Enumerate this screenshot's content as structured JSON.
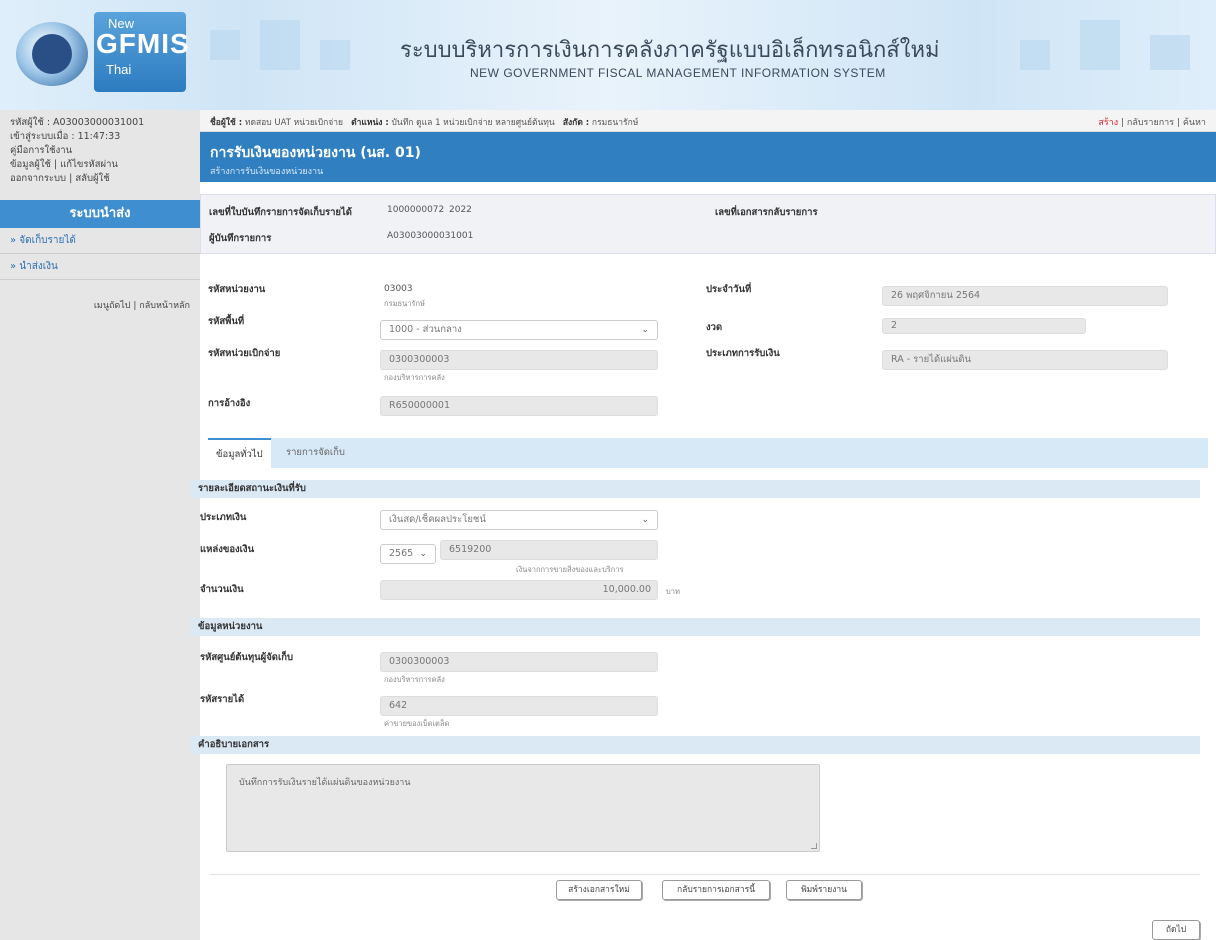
{
  "header": {
    "logo": {
      "new": "New",
      "gfmis": "GFMIS",
      "thai": "Thai"
    },
    "title_th": "ระบบบริหารการเงินการคลังภาครัฐแบบอิเล็กทรอนิกส์ใหม่",
    "title_en": "NEW GOVERNMENT FISCAL MANAGEMENT INFORMATION SYSTEM"
  },
  "sidebar": {
    "user_code": "รหัสผู้ใช้ : A03003000031001",
    "login_time": "เข้าสู่ระบบเมื่อ : 11:47:33",
    "manual": "คู่มือการใช้งาน",
    "user_info": "ข้อมูลผู้ใช้",
    "password": "แก้ไขรหัสผ่าน",
    "logout": "ออกจากระบบ",
    "switch_user": "สลับผู้ใช้",
    "title": "ระบบนำส่ง",
    "menu": [
      "» จัดเก็บรายได้",
      "» นำส่งเงิน"
    ],
    "next_page": "เมนูถัดไป",
    "home": "กลับหน้าหลัก"
  },
  "topbar": {
    "user_label": "ชื่อผู้ใช้ :",
    "user_value": "ทดสอบ UAT หน่วยเบิกจ่าย",
    "position_label": "ตำแหน่ง :",
    "position_value": "บันทึก ดูแล 1 หน่วยเบิกจ่าย หลายศูนย์ต้นทุน",
    "org_label": "สังกัด :",
    "org_value": "กรมธนารักษ์",
    "create": "สร้าง",
    "back_list": "กลับรายการ",
    "search": "ค้นหา"
  },
  "title": {
    "main": "การรับเงินของหน่วยงาน (นส. 01)",
    "sub": "สร้างการรับเงินของหน่วยงาน"
  },
  "doc": {
    "doc_no_label": "เลขที่ใบบันทึกรายการจัดเก็บรายได้",
    "doc_no_value": "1000000072",
    "doc_year": "2022",
    "ref_doc_label": "เลขที่เอกสารกลับรายการ",
    "recorder_label": "ผู้บันทึกรายการ",
    "recorder_value": "A03003000031001"
  },
  "form": {
    "agency_label": "รหัสหน่วยงาน",
    "agency_value": "03003",
    "agency_name": "กรมธนารักษ์",
    "date_label": "ประจำวันที่",
    "date_value": "26 พฤศจิกายน 2564",
    "area_label": "รหัสพื้นที่",
    "area_value": "1000 - ส่วนกลาง",
    "period_label": "งวด",
    "period_value": "2",
    "disb_label": "รหัสหน่วยเบิกจ่าย",
    "disb_value": "0300300003",
    "disb_name": "กองบริหารการคลัง",
    "type_label": "ประเภทการรับเงิน",
    "type_value": "RA - รายได้แผ่นดิน",
    "ref_label": "การอ้างอิง",
    "ref_value": "R650000001"
  },
  "tabs": [
    "ข้อมูลทั่วไป",
    "รายการจัดเก็บ"
  ],
  "money": {
    "section": "รายละเอียดสถานะเงินที่รับ",
    "money_type_label": "ประเภทเงิน",
    "money_type_value": "เงินสด/เช็คผลประโยชน์",
    "source_label": "แหล่งของเงิน",
    "source_year": "2565",
    "source_code": "6519200",
    "source_name": "เงินจากการขายสิ่งของและบริการ",
    "amount_label": "จำนวนเงิน",
    "amount_value": "10,000.00",
    "currency": "บาท"
  },
  "agency": {
    "section": "ข้อมูลหน่วยงาน",
    "cost_center_label": "รหัสศูนย์ต้นทุนผู้จัดเก็บ",
    "cost_center_value": "0300300003",
    "cost_center_name": "กองบริหารการคลัง",
    "revenue_label": "รหัสรายได้",
    "revenue_value": "642",
    "revenue_name": "ค่าขายของเบ็ดเตล็ด"
  },
  "desc": {
    "section": "คำอธิบายเอกสาร",
    "text": "บันทึกการรับเงินรายได้แผ่นดินของหน่วยงาน"
  },
  "buttons": {
    "new_doc": "สร้างเอกสารใหม่",
    "back_main": "กลับรายการเอกสารนี้",
    "print": "พิมพ์รายงาน",
    "next": "ถัดไป"
  }
}
